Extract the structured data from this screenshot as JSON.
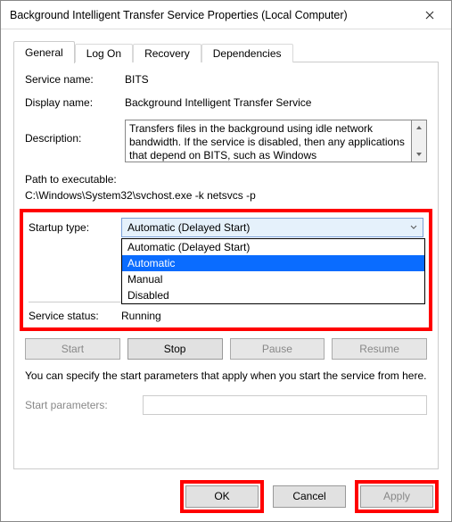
{
  "window": {
    "title": "Background Intelligent Transfer Service Properties (Local Computer)"
  },
  "tabs": {
    "general": "General",
    "logon": "Log On",
    "recovery": "Recovery",
    "dependencies": "Dependencies"
  },
  "general": {
    "service_name_label": "Service name:",
    "service_name": "BITS",
    "display_name_label": "Display name:",
    "display_name": "Background Intelligent Transfer Service",
    "description_label": "Description:",
    "description": "Transfers files in the background using idle network bandwidth. If the service is disabled, then any applications that depend on BITS, such as Windows",
    "path_label": "Path to executable:",
    "path_value": "C:\\Windows\\System32\\svchost.exe -k netsvcs -p",
    "startup_type_label": "Startup type:",
    "startup_type_selected": "Automatic (Delayed Start)",
    "startup_options": {
      "opt0": "Automatic (Delayed Start)",
      "opt1": "Automatic",
      "opt2": "Manual",
      "opt3": "Disabled"
    },
    "service_status_label": "Service status:",
    "service_status": "Running",
    "buttons": {
      "start": "Start",
      "stop": "Stop",
      "pause": "Pause",
      "resume": "Resume"
    },
    "hint": "You can specify the start parameters that apply when you start the service from here.",
    "start_params_label": "Start parameters:",
    "start_params_value": ""
  },
  "footer": {
    "ok": "OK",
    "cancel": "Cancel",
    "apply": "Apply"
  }
}
